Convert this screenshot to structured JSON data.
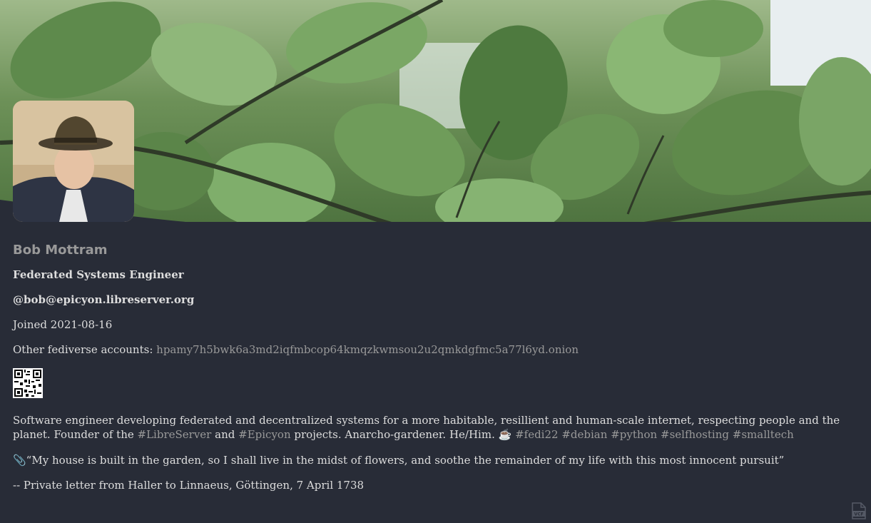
{
  "profile": {
    "display_name": "Bob Mottram",
    "title": "Federated Systems Engineer",
    "handle": "@bob@epicyon.libreserver.org",
    "joined": "Joined 2021-08-16",
    "other_accounts_label": "Other fediverse accounts:",
    "other_accounts_value": "hpamy7h5bwk6a3md2iqfmbcop64kmqzkwmsou2u2qmkdgfmc5a77l6yd.onion"
  },
  "bio": {
    "line1": "Software engineer developing federated and decentralized systems for a more habitable, resillient and human-scale internet, respecting people and the planet.",
    "founder_prefix": "Founder of the",
    "tag_libreserver": "#LibreServer",
    "and_text": "and",
    "tag_epicyon": "#Epicyon",
    "projects_text": "projects. Anarcho-gardener. He/Him. ☕",
    "tag_fedi22": "#fedi22",
    "tag_debian": "#debian",
    "tag_python": "#python",
    "tag_selfhosting": "#selfhosting",
    "tag_smalltech": "#smalltech",
    "quote": "📎“My house is built in the garden, so I shall live in the midst of flowers, and soothe the remainder of my life with this most innocent pursuit”",
    "attribution": "-- Private letter from Haller to Linnaeus, Göttingen, 7 April 1738"
  },
  "icons": {
    "qr": "qr-code-icon",
    "vcard": "vcard-icon",
    "vcard_label": "VCF"
  },
  "colors": {
    "background": "#282c37",
    "text": "#dddddd",
    "muted": "#999999"
  }
}
